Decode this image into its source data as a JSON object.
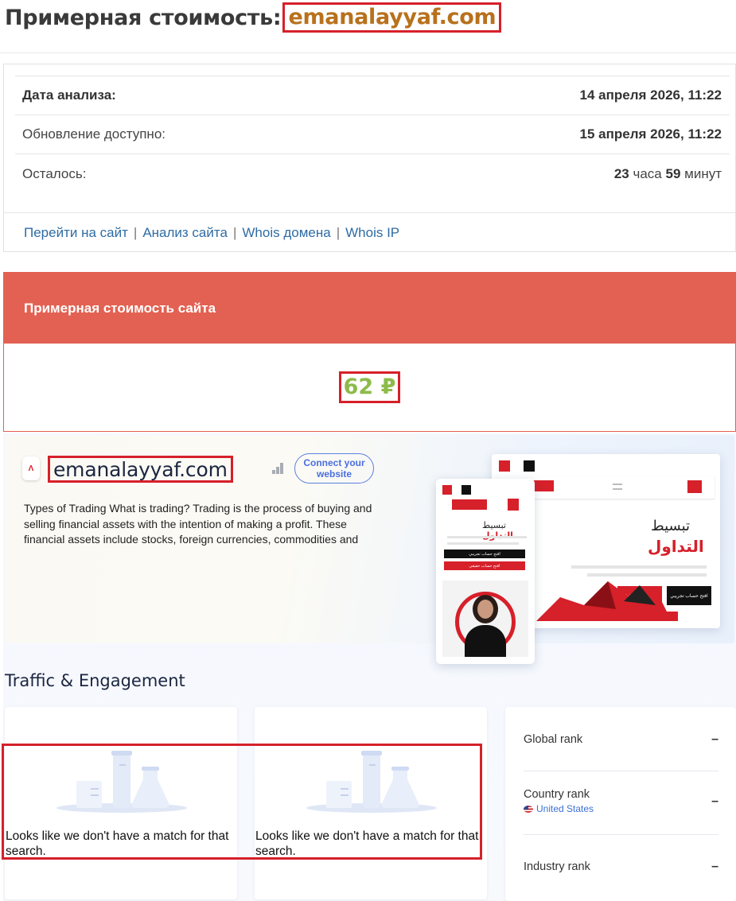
{
  "page": {
    "title_prefix": "Примерная стоимость:",
    "title_domain": "emanalayyaf.com"
  },
  "info": {
    "rows": [
      {
        "label": "Дата анализа:",
        "value": "14 апреля 2026, 11:22"
      },
      {
        "label": "Обновление доступно:",
        "value": "15 апреля 2026, 11:22"
      },
      {
        "label": "Осталось:",
        "hours": "23",
        "hours_unit": "часа",
        "minutes": "59",
        "minutes_unit": "минут"
      }
    ],
    "links": [
      "Перейти на сайт",
      "Анализ сайта",
      "Whois домена",
      "Whois IP"
    ],
    "separator": "|"
  },
  "valuation": {
    "heading": "Примерная стоимость сайта",
    "amount": "62 ₽",
    "amount_color": "#8dbb4a",
    "header_color": "#e36152"
  },
  "similarweb": {
    "domain": "emanalayyaf.com",
    "favicon": "Ʌ",
    "connect_label": "Connect your website",
    "description": "Types of Trading What is trading? Trading is the process of buying and selling financial assets with the intention of making a profit. These financial assets include stocks, foreign currencies, commodities and",
    "mock": {
      "desktop_heading_1": "تبسيط",
      "desktop_heading_2": "التداول",
      "desktop_btn_1": "افتح حساب تجريبي",
      "desktop_btn_2": "افتح حساب حقيقي",
      "mobile_heading_1": "تبسيط",
      "mobile_heading_2": "التداول",
      "mobile_btn_1": "افتح حساب تجريبي",
      "mobile_btn_2": "افتح حساب حقيقي"
    },
    "section_title": "Traffic & Engagement",
    "empty_message": "Looks like we don't have a match for that search.",
    "ranks": [
      {
        "label": "Global rank",
        "value": "–"
      },
      {
        "label": "Country rank",
        "sub": "United States",
        "value": "–"
      },
      {
        "label": "Industry rank",
        "value": "–"
      }
    ],
    "accent": "#d6202a"
  }
}
